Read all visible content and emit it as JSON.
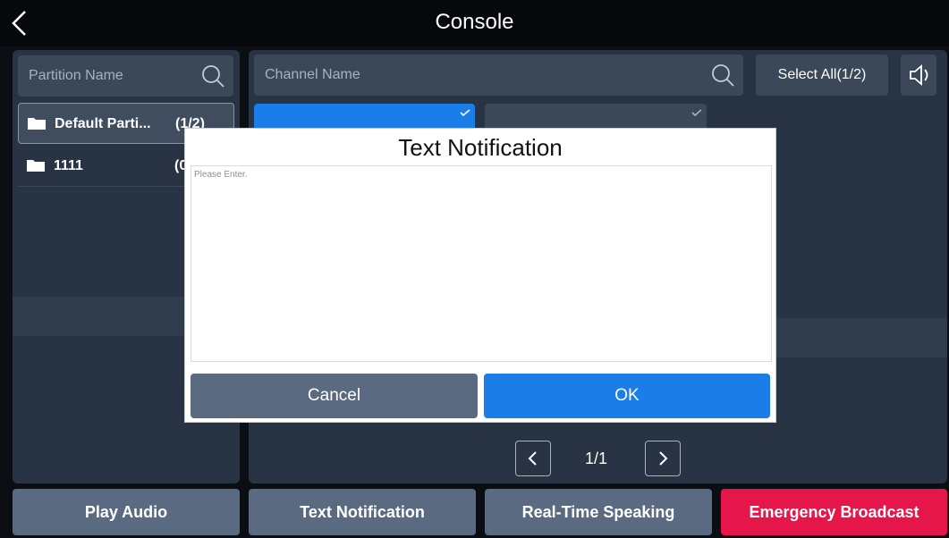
{
  "header": {
    "title": "Console",
    "back_icon": "chevron-left-icon"
  },
  "left_panel": {
    "search_placeholder": "Partition Name",
    "search_icon": "search-icon",
    "partitions": [
      {
        "name": "Default Parti...",
        "count": "(1/2)",
        "selected": true,
        "icon": "folder-icon"
      },
      {
        "name": "1111",
        "count": "(0",
        "selected": false,
        "icon": "folder-icon"
      }
    ]
  },
  "right_panel": {
    "search_placeholder": "Channel Name",
    "search_icon": "search-icon",
    "select_all_label": "Select All(1/2)",
    "speaker_icon": "speaker-icon",
    "channels": [
      {
        "state": "selected",
        "color": "#1a7de8"
      },
      {
        "state": "unselected",
        "color": "#3b4858"
      }
    ],
    "pagination": {
      "prev_icon": "chevron-left-icon",
      "text": "1/1",
      "next_icon": "chevron-right-icon"
    }
  },
  "bottom_actions": [
    {
      "label": "Play Audio",
      "color": "#5a6a80"
    },
    {
      "label": "Text Notification",
      "color": "#5a6a80"
    },
    {
      "label": "Real-Time Speaking",
      "color": "#5a6a80"
    },
    {
      "label": "Emergency Broadcast",
      "color": "#e5164a"
    }
  ],
  "modal": {
    "title": "Text Notification",
    "input_placeholder": "Please Enter.",
    "cancel_label": "Cancel",
    "ok_label": "OK",
    "ok_color": "#1a7de8",
    "cancel_color": "#5a6a80"
  }
}
